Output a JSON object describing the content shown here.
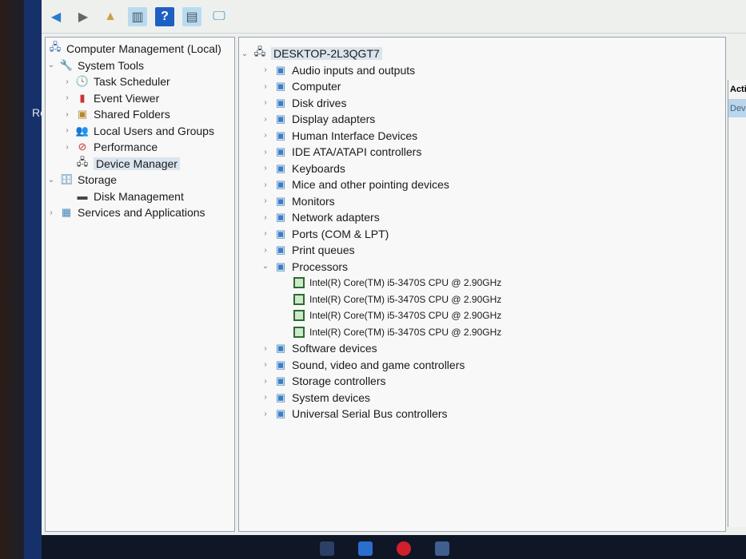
{
  "desktop_fragment": "Re",
  "toolbar": [
    {
      "icon": "back-arrow-icon"
    },
    {
      "icon": "forward-arrow-icon"
    },
    {
      "icon": "up-folder-icon"
    },
    {
      "icon": "show-hide-console-tree-icon"
    },
    {
      "icon": "help-icon"
    },
    {
      "icon": "show-hide-action-pane-icon"
    },
    {
      "icon": "monitor-icon"
    }
  ],
  "tree": {
    "root": "Computer Management (Local)",
    "system_tools": "System Tools",
    "items": [
      "Task Scheduler",
      "Event Viewer",
      "Shared Folders",
      "Local Users and Groups",
      "Performance",
      "Device Manager"
    ],
    "storage": "Storage",
    "disk_management": "Disk Management",
    "services": "Services and Applications"
  },
  "devices": {
    "computer": "DESKTOP-2L3QGT7",
    "categories": [
      "Audio inputs and outputs",
      "Computer",
      "Disk drives",
      "Display adapters",
      "Human Interface Devices",
      "IDE ATA/ATAPI controllers",
      "Keyboards",
      "Mice and other pointing devices",
      "Monitors",
      "Network adapters",
      "Ports (COM & LPT)",
      "Print queues"
    ],
    "processors": "Processors",
    "cpus": [
      "Intel(R) Core(TM) i5-3470S CPU @ 2.90GHz",
      "Intel(R) Core(TM) i5-3470S CPU @ 2.90GHz",
      "Intel(R) Core(TM) i5-3470S CPU @ 2.90GHz",
      "Intel(R) Core(TM) i5-3470S CPU @ 2.90GHz"
    ],
    "after": [
      "Software devices",
      "Sound, video and game controllers",
      "Storage controllers",
      "System devices",
      "Universal Serial Bus controllers"
    ]
  },
  "actions": {
    "header": "Actio",
    "selected": "Devi"
  }
}
